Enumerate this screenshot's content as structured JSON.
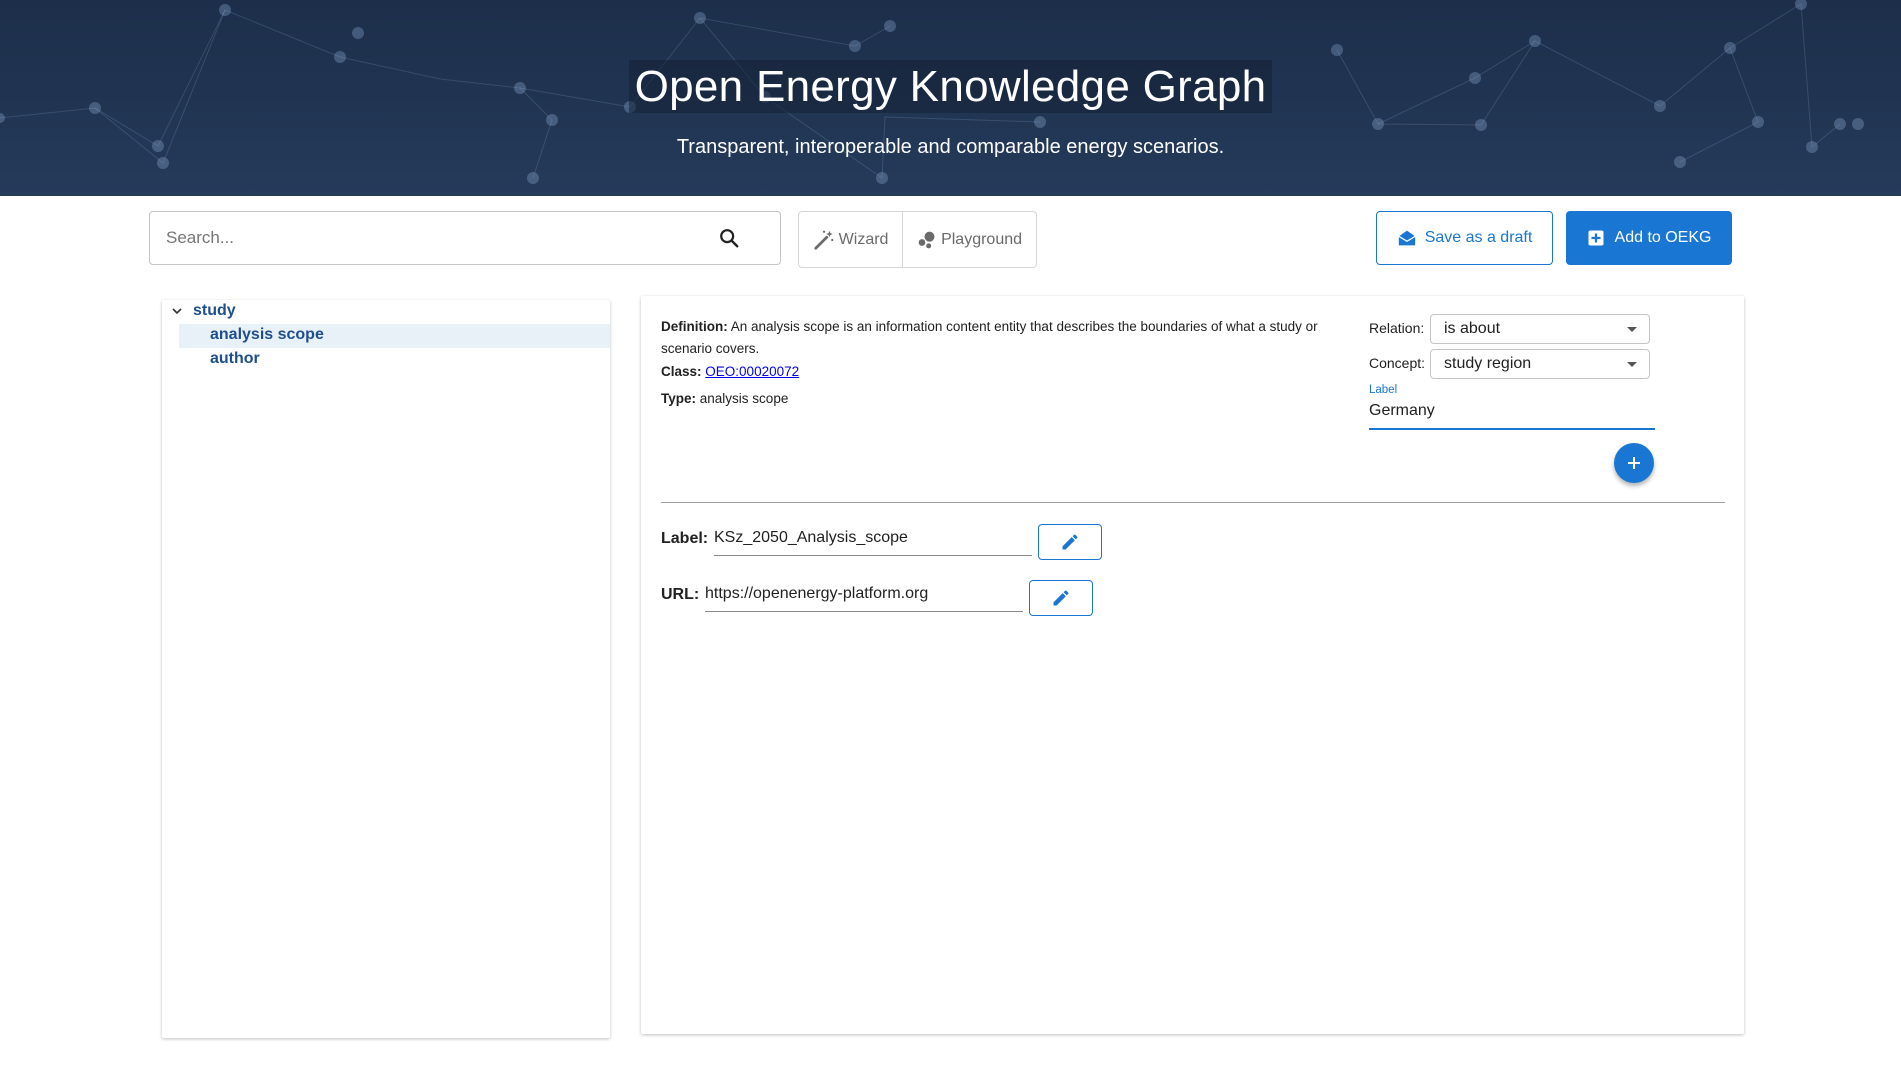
{
  "header": {
    "title": "Open Energy Knowledge Graph",
    "subtitle": "Transparent, interoperable and comparable energy scenarios."
  },
  "toolbar": {
    "search_placeholder": "Search...",
    "wizard_label": "Wizard",
    "playground_label": "Playground",
    "draft_label": "Save as a draft",
    "add_label": "Add to OEKG"
  },
  "tree": {
    "root": "study",
    "children": [
      "analysis scope",
      "author"
    ],
    "selected": "analysis scope"
  },
  "detail": {
    "definition_key": "Definition:",
    "definition_text": "An analysis scope is an information content entity that describes the boundaries of what a study or scenario covers.",
    "class_key": "Class:",
    "class_value": "OEO:00020072",
    "type_key": "Type:",
    "type_value": "analysis scope"
  },
  "relation_form": {
    "relation_label": "Relation:",
    "relation_value": "is about",
    "concept_label": "Concept:",
    "concept_value": "study region",
    "label_caption": "Label",
    "label_value": "Germany"
  },
  "fields": {
    "label_key": "Label:",
    "label_value": "KSz_2050_Analysis_scope",
    "url_key": "URL:",
    "url_value": "https://openenergy-platform.org"
  },
  "colors": {
    "primary": "#1976d2",
    "header_bg": "#1c2e4a",
    "tree_text": "#1f4e8c"
  }
}
